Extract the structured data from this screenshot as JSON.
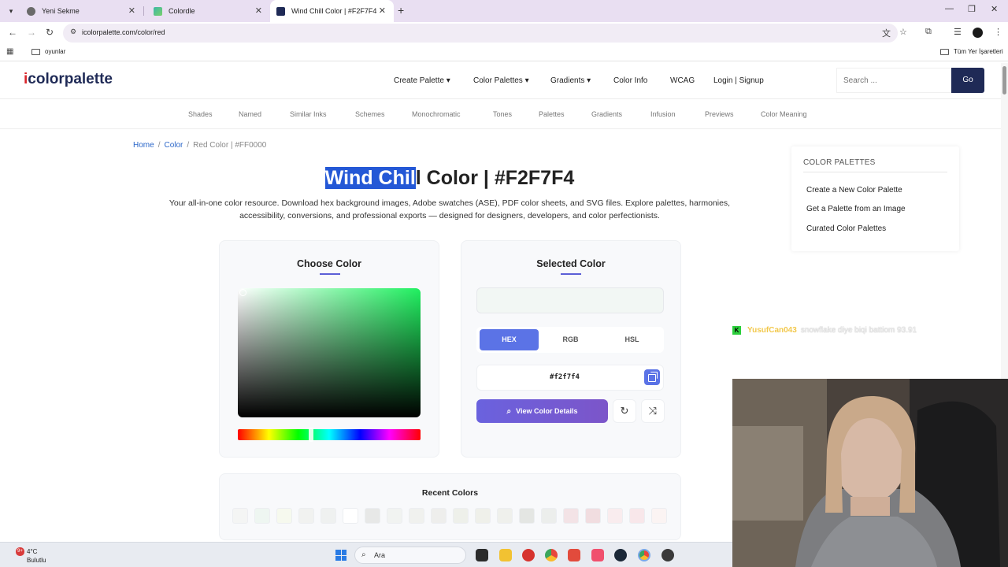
{
  "browser": {
    "tabs": [
      {
        "title": "Yeni Sekme",
        "active": false
      },
      {
        "title": "Colordle",
        "active": false
      },
      {
        "title": "Wind Chill Color | #F2F7F4",
        "active": true
      }
    ],
    "url": "icolorpalette.com/color/red",
    "bookmarks": {
      "left_folder": "oyunlar",
      "right_folder": "Tüm Yer İşaretleri"
    }
  },
  "site": {
    "logo_i": "i",
    "logo_rest": "colorpalette",
    "nav": [
      "Create Palette",
      "Color Palettes",
      "Gradients",
      "Color Info",
      "WCAG",
      "Login | Signup"
    ],
    "search_placeholder": "Search ...",
    "go_label": "Go",
    "subnav": [
      "Shades",
      "Named",
      "Similar Inks",
      "Schemes",
      "Monochromatic",
      "Tones",
      "Palettes",
      "Gradients",
      "Infusion",
      "Previews",
      "Color Meaning"
    ]
  },
  "breadcrumb": {
    "home": "Home",
    "color": "Color",
    "current": "Red Color | #FF0000"
  },
  "title": {
    "selected_part": "Wind Chil",
    "rest": "l Color | #F2F7F4"
  },
  "intro": "Your all-in-one color resource. Download hex background images, Adobe swatches (ASE), PDF color sheets, and SVG files. Explore palettes, harmonies, accessibility, conversions, and professional exports — designed for designers, developers, and color perfectionists.",
  "sidebar": {
    "heading": "COLOR PALETTES",
    "links": [
      "Create a New Color Palette",
      "Get a Palette from an Image",
      "Curated Color Palettes"
    ]
  },
  "choose_panel": {
    "title": "Choose Color"
  },
  "selected_panel": {
    "title": "Selected Color",
    "preview_color": "#f2f7f4",
    "modes": [
      "HEX",
      "RGB",
      "HSL"
    ],
    "active_mode": "HEX",
    "hex_value": "#f2f7f4",
    "view_button": "View Color Details"
  },
  "recent": {
    "title": "Recent Colors",
    "swatches": [
      "#f4f5f4",
      "#eef6f1",
      "#f6f9ee",
      "#f1f2f0",
      "#eff1f0",
      "#ffffff",
      "#e7e8e7",
      "#f1f3f1",
      "#f0f1ee",
      "#eeeeec",
      "#eef0ea",
      "#eff0ea",
      "#eff0ec",
      "#e4e6e3",
      "#eceeec",
      "#f3e3e6",
      "#f1dde0",
      "#f9ecee",
      "#f8e7ea",
      "#fbf4f3"
    ]
  },
  "chat": {
    "platform_glyph": "K",
    "username": "YusufCan043",
    "message": "snowflake diye biqi battiom 93.91"
  },
  "taskbar": {
    "weather_temp": "4°C",
    "weather_desc": "Bulutlu",
    "badge": "9+",
    "search_label": "Ara"
  }
}
